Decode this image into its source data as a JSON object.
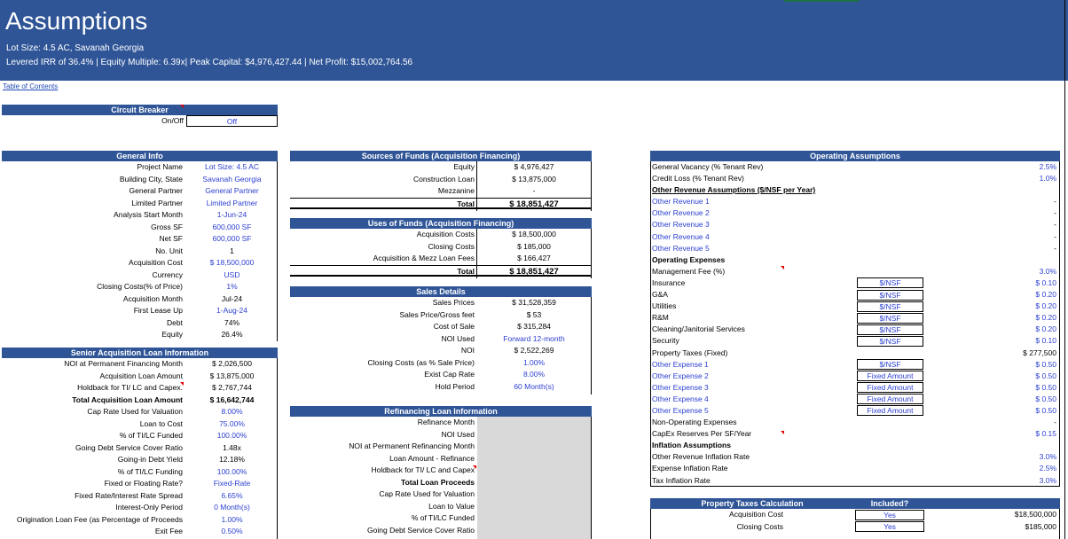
{
  "header": {
    "title": "Assumptions",
    "subtitle1": "Lot Size: 4.5 AC, Savanah Georgia",
    "subtitle2": "Levered IRR of 36.4% | Equity Multiple: 6.39x| Peak Capital: $4,976,427.44 | Net Profit: $15,002,764.56"
  },
  "toc": "Table of Contents",
  "circuit_breaker": {
    "title": "Circuit Breaker",
    "label": "On/Off",
    "value": "Off"
  },
  "general_info": {
    "title": "General Info",
    "rows": [
      {
        "label": "Project Name",
        "value": "Lot Size: 4.5 AC"
      },
      {
        "label": "Building City, State",
        "value": "Savanah Georgia"
      },
      {
        "label": "General Partner",
        "value": "General Partner"
      },
      {
        "label": "Limited Partner",
        "value": "Limited Partner"
      },
      {
        "label": "Analysis Start Month",
        "value": "1-Jun-24"
      },
      {
        "label": "Gross SF",
        "value": "600,000 SF"
      },
      {
        "label": "Net SF",
        "value": "600,000 SF"
      },
      {
        "label": "No. Unit",
        "value": "1"
      },
      {
        "label": "Acquisition Cost",
        "value": "$ 18,500,000"
      },
      {
        "label": "Currency",
        "value": "USD"
      },
      {
        "label": "Closing Costs(% of Price)",
        "value": "1%"
      },
      {
        "label": "Acquisition Month",
        "value": "Jul-24"
      },
      {
        "label": "First Lease Up",
        "value": "1-Aug-24"
      },
      {
        "label": "Debt",
        "value": "74%"
      },
      {
        "label": "Equity",
        "value": "26.4%"
      }
    ]
  },
  "senior_loan": {
    "title": "Senior Acquisition Loan Information",
    "rows": [
      {
        "label": "NOI at Permanent Financing Month",
        "value": "$ 2,026,500"
      },
      {
        "label": "Acquisition Loan Amount",
        "value": "$ 13,875,000"
      },
      {
        "label": "Holdback for TI/ LC and Capex.",
        "value": "$ 2,767,744"
      },
      {
        "label": "Total Acquisition Loan Amount",
        "value": "$ 16,642,744"
      },
      {
        "label": "Cap Rate Used for Valuation",
        "value": "8.00%"
      },
      {
        "label": "Loan to Cost",
        "value": "75.00%"
      },
      {
        "label": "% of TI/LC Funded",
        "value": "100.00%"
      },
      {
        "label": "Going Debt Service Cover Ratio",
        "value": "1.48x"
      },
      {
        "label": "Going-in Debt Yield",
        "value": "12.18%"
      },
      {
        "label": "% of TI/LC Funding",
        "value": "100.00%"
      },
      {
        "label": "Fixed or Floating Rate?",
        "value": "Fixed-Rate"
      },
      {
        "label": "Fixed Rate/Interest Rate Spread",
        "value": "6.65%"
      },
      {
        "label": "Interest-Only Period",
        "value": "0 Month(s)"
      },
      {
        "label": "Origination Loan Fee (as Percentage of Proceeds",
        "value": "1.00%"
      },
      {
        "label": "Exit Fee",
        "value": "0.50%"
      }
    ]
  },
  "sources": {
    "title": "Sources of Funds (Acquisition Financing)",
    "rows": [
      {
        "label": "Equity",
        "value": "$ 4,976,427"
      },
      {
        "label": "Construction Loan",
        "value": "$ 13,875,000"
      },
      {
        "label": "Mezzanine",
        "value": "-"
      }
    ],
    "total_label": "Total",
    "total_value": "$ 18,851,427"
  },
  "uses": {
    "title": "Uses of Funds (Acquisition Financing)",
    "rows": [
      {
        "label": "Acquisition Costs",
        "value": "$ 18,500,000"
      },
      {
        "label": "Closing Costs",
        "value": "$ 185,000"
      },
      {
        "label": "Acquisition & Mezz Loan Fees",
        "value": "$ 166,427"
      }
    ],
    "total_label": "Total",
    "total_value": "$ 18,851,427"
  },
  "sales": {
    "title": "Sales Details",
    "rows": [
      {
        "label": "Sales Prices",
        "value": "$ 31,528,359"
      },
      {
        "label": "Sales Price/Gross feet",
        "value": "$ 53"
      },
      {
        "label": "Cost of Sale",
        "value": "$ 315,284"
      },
      {
        "label": "NOI Used",
        "value": "Forward 12-month"
      },
      {
        "label": "NOI",
        "value": "$ 2,522,269"
      },
      {
        "label": "Closing Costs (as % Sale Price)",
        "value": "1.00%"
      },
      {
        "label": "Exist Cap Rate",
        "value": "8.00%"
      },
      {
        "label": "Hold Period",
        "value": "60 Month(s)"
      }
    ]
  },
  "refinancing": {
    "title": "Refinancing Loan Information",
    "rows": [
      {
        "label": "Refinance Month"
      },
      {
        "label": "NOI Used"
      },
      {
        "label": "NOI at Permanent Refinancing Month"
      },
      {
        "label": "Loan Amount - Refinance"
      },
      {
        "label": "Holdback for TI/ LC and Capex"
      },
      {
        "label": "Total Loan Proceeds"
      },
      {
        "label": "Cap Rate Used for Valuation"
      },
      {
        "label": "Loan to Value"
      },
      {
        "label": "% of TI/LC Funded"
      },
      {
        "label": "Going Debt Service Cover Ratio"
      }
    ]
  },
  "operating": {
    "title": "Operating Assumptions",
    "rows": [
      {
        "label": "General Vacancy (% Tenant Rev)",
        "value": "2.5%",
        "blue": true
      },
      {
        "label": "Credit Loss (% Tenant Rev)",
        "value": "1.0%",
        "blue": true
      },
      {
        "label": "Other  Revenue Assumptions ($/NSF per Year)",
        "section": true
      },
      {
        "label": "Other Revenue 1",
        "value": "-",
        "blue_label": true
      },
      {
        "label": "Other Revenue 2",
        "value": "-",
        "blue_label": true
      },
      {
        "label": "Other Revenue 3",
        "value": "-",
        "blue_label": true
      },
      {
        "label": "Other Revenue 4",
        "value": "-",
        "blue_label": true
      },
      {
        "label": "Other Revenue 5",
        "value": "-",
        "blue_label": true
      },
      {
        "label": "Operating Expenses",
        "bold": true
      },
      {
        "label": "Management Fee (%)",
        "value": "3.0%",
        "blue": true
      },
      {
        "label": "Insurance",
        "unit": "$/NSF",
        "value": "$ 0.10",
        "blue": true
      },
      {
        "label": "G&A",
        "unit": "$/NSF",
        "value": "$ 0.20",
        "blue": true
      },
      {
        "label": "Utilities",
        "unit": "$/NSF",
        "value": "$ 0.20",
        "blue": true
      },
      {
        "label": "R&M",
        "unit": "$/NSF",
        "value": "$ 0.20",
        "blue": true
      },
      {
        "label": "Cleaning/Janitorial Services",
        "unit": "$/NSF",
        "value": "$ 0.20",
        "blue": true
      },
      {
        "label": "Security",
        "unit": "$/NSF",
        "value": "$ 0.10",
        "blue": true
      },
      {
        "label": "Property Taxes (Fixed)",
        "value": "$ 277,500"
      },
      {
        "label": "Other Expense 1",
        "unit": "$/NSF",
        "value": "$ 0.50",
        "blue": true,
        "blue_label": true
      },
      {
        "label": "Other Expense 2",
        "unit": "Fixed Amount",
        "value": "$ 0.50",
        "blue": true,
        "blue_label": true
      },
      {
        "label": "Other Expense 3",
        "unit": "Fixed Amount",
        "value": "$ 0.50",
        "blue": true,
        "blue_label": true
      },
      {
        "label": "Other Expense 4",
        "unit": "Fixed Amount",
        "value": "$ 0.50",
        "blue": true,
        "blue_label": true
      },
      {
        "label": "Other Expense 5",
        "unit": "Fixed Amount",
        "value": "$ 0.50",
        "blue": true,
        "blue_label": true
      },
      {
        "label": "Non-Operating Expenses",
        "value": "-"
      },
      {
        "label": "CapEx Reserves Per SF/Year",
        "value": "$ 0.15",
        "blue": true
      },
      {
        "label": "Inflation Assumptions",
        "bold": true
      },
      {
        "label": "Other Revenue Inflation Rate",
        "value": "3.0%",
        "blue": true
      },
      {
        "label": "Expense Inflation Rate",
        "value": "2.5%",
        "blue": true
      },
      {
        "label": "Tax Inflation Rate",
        "value": "3.0%",
        "blue": true
      }
    ]
  },
  "property_taxes": {
    "title": "Property Taxes Calculation",
    "included_header": "Included?",
    "rows": [
      {
        "label": "Acquisition Cost",
        "included": "Yes",
        "value": "$18,500,000"
      },
      {
        "label": "Closing Costs",
        "included": "Yes",
        "value": "$185,000"
      }
    ]
  },
  "colors": {
    "header_bg": "#2f5597",
    "input_blue": "#2b3fd0",
    "grey_fill": "#d9d9d9"
  }
}
